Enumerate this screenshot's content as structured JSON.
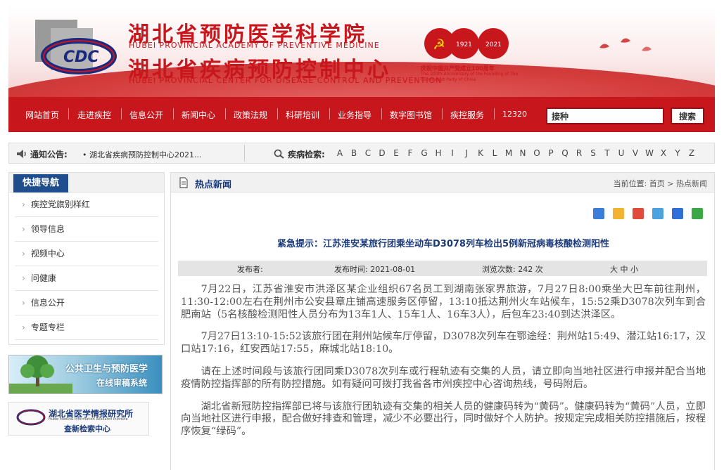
{
  "header": {
    "org_cn_1": "湖北省预防医学科学院",
    "org_en_1": "HUBEI PROVINCIAL ACADEMY OF PREVENTIVE MEDICINE",
    "org_cn_2": "湖北省疾病预防控制中心",
    "org_en_2": "HUBEI PROVINCIAL CENTER FOR DISEASE CONTROL AND PREVENTION",
    "logo_text": "CDC",
    "anniv_years_1": "1921",
    "anniv_years_2": "2021",
    "anniv_number": "100",
    "anniv_cn": "庆祝中国共产党成立100周年",
    "anniv_en": "The 100th Anniversary of the Founding of The Communist Party of China"
  },
  "nav": {
    "items": [
      "网站首页",
      "走进疾控",
      "信息公开",
      "新闻中心",
      "政策法规",
      "科研培训",
      "业务指导",
      "数字图书馆",
      "疾控服务",
      "12320"
    ],
    "search_value": "接种",
    "search_button": "搜索"
  },
  "notice": {
    "label": "通知公告:",
    "text": "• 湖北省疾病预防控制中心2021...",
    "disease_label": "疾病检索:",
    "letters": [
      "A",
      "B",
      "C",
      "D",
      "E",
      "F",
      "G",
      "H",
      "I",
      "J",
      "K",
      "L",
      "M",
      "N",
      "O",
      "P",
      "Q",
      "R",
      "S",
      "T",
      "U",
      "V",
      "W",
      "X",
      "Y",
      "Z"
    ]
  },
  "sidebar": {
    "title": "快捷导航",
    "items": [
      "疾控党旗别样红",
      "领导信息",
      "视频中心",
      "问健康",
      "信息公开",
      "专题专栏"
    ],
    "banner1_line1": "公共卫生与预防医学",
    "banner1_line2": "在线审稿系统",
    "banner2_line1": "湖北省医学情报研究所",
    "banner2_line2": "Hubei Medical Information Research Institute",
    "banner2_line3": "查新检索中心"
  },
  "main": {
    "section_title": "热点新闻",
    "breadcrumb": "当前位置: 首页 > 热点新闻",
    "article_title": "紧急提示：江苏淮安某旅行团乘坐动车D3078列车检出5例新冠病毒核酸检测阳性",
    "meta": {
      "publisher": "发布者:",
      "publish_time": "发布时间: 2021-08-01",
      "views": "浏览次数: 242 次",
      "font_size": "大 中 小"
    },
    "paragraphs": [
      "7月22日，江苏省淮安市洪泽区某企业组织67名员工到湖南张家界旅游，7月27日8:00乘坐大巴车前往荆州，11:30-12:00左右在荆州市公安县章庄铺高速服务区停留，13:10抵达荆州火车站候车，15:52乘D3078次列车到合肥南站（5名核酸检测阳性人员分布为13车1人、15车1人、16车3人），后包车23:40到达洪泽区。",
      "7月27日13:10-15:52该旅行团在荆州站候车厅停留，D3078次列车在鄂途经：荆州站15:49、潜江站16:17，汉口站17:16，红安西站17:55，麻城北站18:10。",
      "请在上述时间段与该旅行团同乘D3078次列车或行程轨迹有交集的人员，请立即向当地社区进行申报并配合当地疫情防控指挥部的所有防控措施。如有疑问可拨打我省各市州疾控中心咨询热线，号码附后。",
      "湖北省新冠防控指挥部已将与该旅行团轨迹有交集的相关人员的健康码转为“黄码”。健康码转为“黄码”人员，立即向当地社区进行申报，配合做好排查和管理，减少不必要出行，同时做好个人防护。按规定完成相关防控措施后，按程序恢复“绿码”。"
    ]
  },
  "colors": {
    "brand_red": "#c8161d",
    "nav_blue": "#1f4e8f",
    "title_blue": "#1a3a7a"
  }
}
